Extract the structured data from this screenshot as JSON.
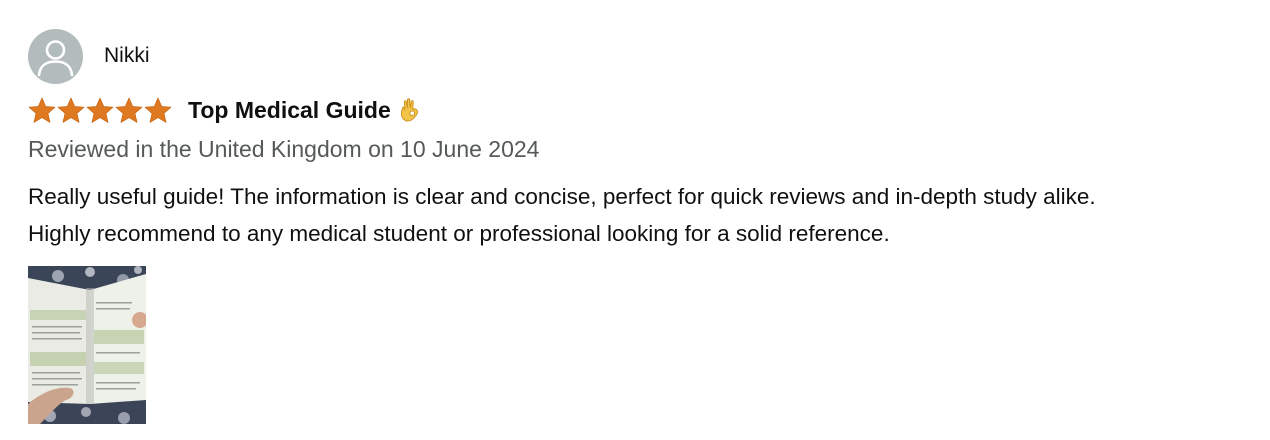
{
  "reviewer": {
    "name": "Nikki",
    "avatar_icon": "person-silhouette-icon"
  },
  "rating": {
    "stars": 5,
    "max_stars": 5,
    "star_color": "#de7921"
  },
  "review": {
    "title": "Top Medical Guide",
    "title_emoji": "ok-hand-emoji",
    "meta": "Reviewed in the United Kingdom on 10 June 2024",
    "body_lines": [
      "Really useful guide! The information is clear and concise, perfect for quick reviews and in-depth study alike.",
      "Highly recommend to any medical student or professional looking for a solid reference."
    ]
  },
  "media": {
    "image_count": 1
  }
}
